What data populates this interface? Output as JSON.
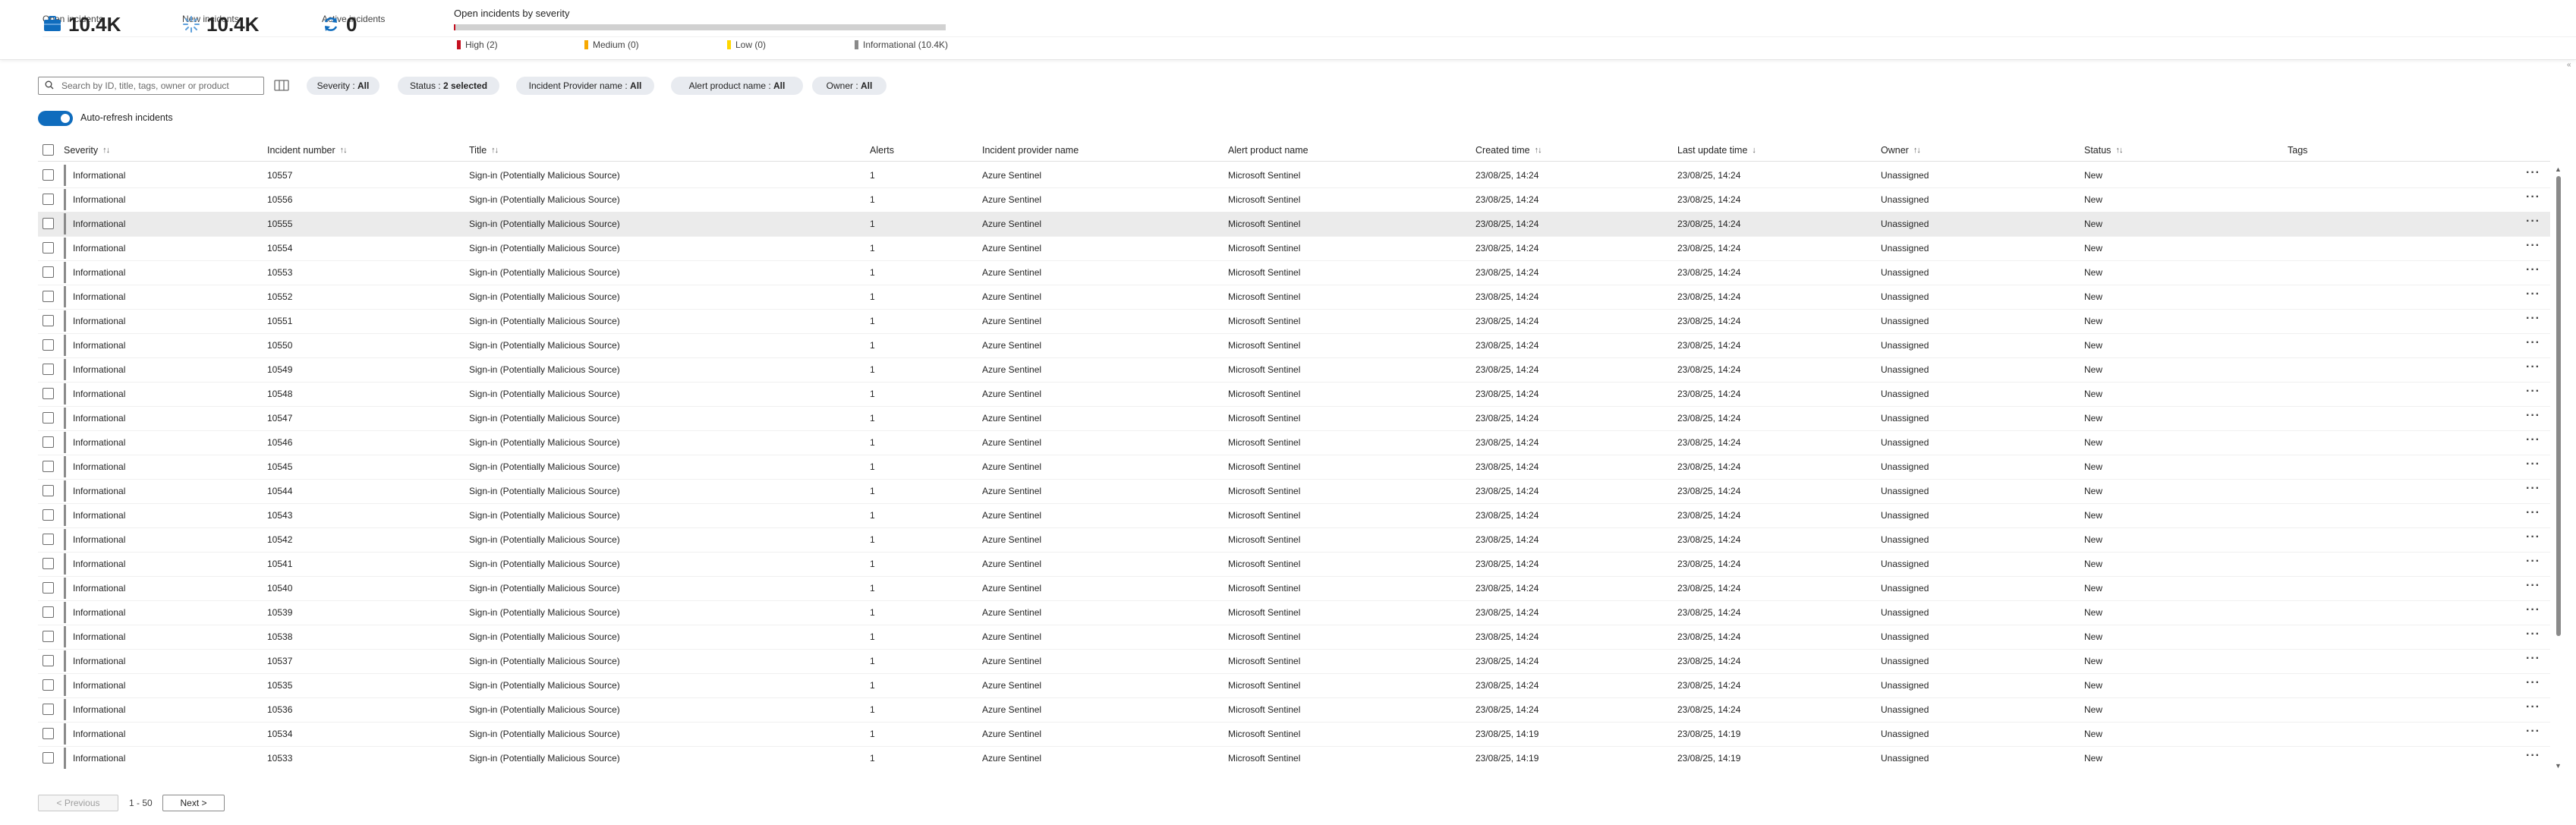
{
  "kpis": [
    {
      "value": "10.4K",
      "label": "Open incidents",
      "icon": "briefcase-icon"
    },
    {
      "value": "10.4K",
      "label": "New incidents",
      "icon": "sparkle-icon"
    },
    {
      "value": "0",
      "label": "Active incidents",
      "icon": "refresh-icon"
    }
  ],
  "severity_summary": {
    "title": "Open incidents by severity",
    "high_fraction": 0.0002,
    "legend": [
      {
        "label": "High (2)",
        "color": "#c50f1f"
      },
      {
        "label": "Medium (0)",
        "color": "#f7a800"
      },
      {
        "label": "Low (0)",
        "color": "#ffd700"
      },
      {
        "label": "Informational (10.4K)",
        "color": "#8a8a8a"
      }
    ]
  },
  "search": {
    "placeholder": "Search by ID, title, tags, owner or product",
    "value": ""
  },
  "filters": [
    {
      "name": "Severity : ",
      "value": "All"
    },
    {
      "name": "Status : ",
      "value": "2 selected"
    },
    {
      "name": "Incident Provider name : ",
      "value": "All"
    },
    {
      "name": "Alert product name : ",
      "value": "All"
    },
    {
      "name": "Owner : ",
      "value": "All"
    }
  ],
  "auto_refresh": {
    "label": "Auto-refresh incidents",
    "enabled": true
  },
  "columns": {
    "severity": "Severity",
    "number": "Incident number",
    "title": "Title",
    "alerts": "Alerts",
    "provider": "Incident provider name",
    "product": "Alert product name",
    "created": "Created time",
    "updated": "Last update time",
    "owner": "Owner",
    "status": "Status",
    "tags": "Tags"
  },
  "sort_icons": {
    "both": "↑↓",
    "desc": "↓"
  },
  "more_label": "···",
  "rows": [
    {
      "severity": "Informational",
      "number": "10557",
      "title": "Sign-in (Potentially Malicious Source)",
      "alerts": "1",
      "provider": "Azure Sentinel",
      "product": "Microsoft Sentinel",
      "created": "23/08/25, 14:24",
      "updated": "23/08/25, 14:24",
      "owner": "Unassigned",
      "status": "New",
      "tags": ""
    },
    {
      "severity": "Informational",
      "number": "10556",
      "title": "Sign-in (Potentially Malicious Source)",
      "alerts": "1",
      "provider": "Azure Sentinel",
      "product": "Microsoft Sentinel",
      "created": "23/08/25, 14:24",
      "updated": "23/08/25, 14:24",
      "owner": "Unassigned",
      "status": "New",
      "tags": ""
    },
    {
      "severity": "Informational",
      "number": "10555",
      "title": "Sign-in (Potentially Malicious Source)",
      "alerts": "1",
      "provider": "Azure Sentinel",
      "product": "Microsoft Sentinel",
      "created": "23/08/25, 14:24",
      "updated": "23/08/25, 14:24",
      "owner": "Unassigned",
      "status": "New",
      "tags": "",
      "highlighted": true
    },
    {
      "severity": "Informational",
      "number": "10554",
      "title": "Sign-in (Potentially Malicious Source)",
      "alerts": "1",
      "provider": "Azure Sentinel",
      "product": "Microsoft Sentinel",
      "created": "23/08/25, 14:24",
      "updated": "23/08/25, 14:24",
      "owner": "Unassigned",
      "status": "New",
      "tags": ""
    },
    {
      "severity": "Informational",
      "number": "10553",
      "title": "Sign-in (Potentially Malicious Source)",
      "alerts": "1",
      "provider": "Azure Sentinel",
      "product": "Microsoft Sentinel",
      "created": "23/08/25, 14:24",
      "updated": "23/08/25, 14:24",
      "owner": "Unassigned",
      "status": "New",
      "tags": ""
    },
    {
      "severity": "Informational",
      "number": "10552",
      "title": "Sign-in (Potentially Malicious Source)",
      "alerts": "1",
      "provider": "Azure Sentinel",
      "product": "Microsoft Sentinel",
      "created": "23/08/25, 14:24",
      "updated": "23/08/25, 14:24",
      "owner": "Unassigned",
      "status": "New",
      "tags": ""
    },
    {
      "severity": "Informational",
      "number": "10551",
      "title": "Sign-in (Potentially Malicious Source)",
      "alerts": "1",
      "provider": "Azure Sentinel",
      "product": "Microsoft Sentinel",
      "created": "23/08/25, 14:24",
      "updated": "23/08/25, 14:24",
      "owner": "Unassigned",
      "status": "New",
      "tags": ""
    },
    {
      "severity": "Informational",
      "number": "10550",
      "title": "Sign-in (Potentially Malicious Source)",
      "alerts": "1",
      "provider": "Azure Sentinel",
      "product": "Microsoft Sentinel",
      "created": "23/08/25, 14:24",
      "updated": "23/08/25, 14:24",
      "owner": "Unassigned",
      "status": "New",
      "tags": ""
    },
    {
      "severity": "Informational",
      "number": "10549",
      "title": "Sign-in (Potentially Malicious Source)",
      "alerts": "1",
      "provider": "Azure Sentinel",
      "product": "Microsoft Sentinel",
      "created": "23/08/25, 14:24",
      "updated": "23/08/25, 14:24",
      "owner": "Unassigned",
      "status": "New",
      "tags": ""
    },
    {
      "severity": "Informational",
      "number": "10548",
      "title": "Sign-in (Potentially Malicious Source)",
      "alerts": "1",
      "provider": "Azure Sentinel",
      "product": "Microsoft Sentinel",
      "created": "23/08/25, 14:24",
      "updated": "23/08/25, 14:24",
      "owner": "Unassigned",
      "status": "New",
      "tags": ""
    },
    {
      "severity": "Informational",
      "number": "10547",
      "title": "Sign-in (Potentially Malicious Source)",
      "alerts": "1",
      "provider": "Azure Sentinel",
      "product": "Microsoft Sentinel",
      "created": "23/08/25, 14:24",
      "updated": "23/08/25, 14:24",
      "owner": "Unassigned",
      "status": "New",
      "tags": ""
    },
    {
      "severity": "Informational",
      "number": "10546",
      "title": "Sign-in (Potentially Malicious Source)",
      "alerts": "1",
      "provider": "Azure Sentinel",
      "product": "Microsoft Sentinel",
      "created": "23/08/25, 14:24",
      "updated": "23/08/25, 14:24",
      "owner": "Unassigned",
      "status": "New",
      "tags": ""
    },
    {
      "severity": "Informational",
      "number": "10545",
      "title": "Sign-in (Potentially Malicious Source)",
      "alerts": "1",
      "provider": "Azure Sentinel",
      "product": "Microsoft Sentinel",
      "created": "23/08/25, 14:24",
      "updated": "23/08/25, 14:24",
      "owner": "Unassigned",
      "status": "New",
      "tags": ""
    },
    {
      "severity": "Informational",
      "number": "10544",
      "title": "Sign-in (Potentially Malicious Source)",
      "alerts": "1",
      "provider": "Azure Sentinel",
      "product": "Microsoft Sentinel",
      "created": "23/08/25, 14:24",
      "updated": "23/08/25, 14:24",
      "owner": "Unassigned",
      "status": "New",
      "tags": ""
    },
    {
      "severity": "Informational",
      "number": "10543",
      "title": "Sign-in (Potentially Malicious Source)",
      "alerts": "1",
      "provider": "Azure Sentinel",
      "product": "Microsoft Sentinel",
      "created": "23/08/25, 14:24",
      "updated": "23/08/25, 14:24",
      "owner": "Unassigned",
      "status": "New",
      "tags": ""
    },
    {
      "severity": "Informational",
      "number": "10542",
      "title": "Sign-in (Potentially Malicious Source)",
      "alerts": "1",
      "provider": "Azure Sentinel",
      "product": "Microsoft Sentinel",
      "created": "23/08/25, 14:24",
      "updated": "23/08/25, 14:24",
      "owner": "Unassigned",
      "status": "New",
      "tags": ""
    },
    {
      "severity": "Informational",
      "number": "10541",
      "title": "Sign-in (Potentially Malicious Source)",
      "alerts": "1",
      "provider": "Azure Sentinel",
      "product": "Microsoft Sentinel",
      "created": "23/08/25, 14:24",
      "updated": "23/08/25, 14:24",
      "owner": "Unassigned",
      "status": "New",
      "tags": ""
    },
    {
      "severity": "Informational",
      "number": "10540",
      "title": "Sign-in (Potentially Malicious Source)",
      "alerts": "1",
      "provider": "Azure Sentinel",
      "product": "Microsoft Sentinel",
      "created": "23/08/25, 14:24",
      "updated": "23/08/25, 14:24",
      "owner": "Unassigned",
      "status": "New",
      "tags": ""
    },
    {
      "severity": "Informational",
      "number": "10539",
      "title": "Sign-in (Potentially Malicious Source)",
      "alerts": "1",
      "provider": "Azure Sentinel",
      "product": "Microsoft Sentinel",
      "created": "23/08/25, 14:24",
      "updated": "23/08/25, 14:24",
      "owner": "Unassigned",
      "status": "New",
      "tags": ""
    },
    {
      "severity": "Informational",
      "number": "10538",
      "title": "Sign-in (Potentially Malicious Source)",
      "alerts": "1",
      "provider": "Azure Sentinel",
      "product": "Microsoft Sentinel",
      "created": "23/08/25, 14:24",
      "updated": "23/08/25, 14:24",
      "owner": "Unassigned",
      "status": "New",
      "tags": ""
    },
    {
      "severity": "Informational",
      "number": "10537",
      "title": "Sign-in (Potentially Malicious Source)",
      "alerts": "1",
      "provider": "Azure Sentinel",
      "product": "Microsoft Sentinel",
      "created": "23/08/25, 14:24",
      "updated": "23/08/25, 14:24",
      "owner": "Unassigned",
      "status": "New",
      "tags": ""
    },
    {
      "severity": "Informational",
      "number": "10535",
      "title": "Sign-in (Potentially Malicious Source)",
      "alerts": "1",
      "provider": "Azure Sentinel",
      "product": "Microsoft Sentinel",
      "created": "23/08/25, 14:24",
      "updated": "23/08/25, 14:24",
      "owner": "Unassigned",
      "status": "New",
      "tags": ""
    },
    {
      "severity": "Informational",
      "number": "10536",
      "title": "Sign-in (Potentially Malicious Source)",
      "alerts": "1",
      "provider": "Azure Sentinel",
      "product": "Microsoft Sentinel",
      "created": "23/08/25, 14:24",
      "updated": "23/08/25, 14:24",
      "owner": "Unassigned",
      "status": "New",
      "tags": ""
    },
    {
      "severity": "Informational",
      "number": "10534",
      "title": "Sign-in (Potentially Malicious Source)",
      "alerts": "1",
      "provider": "Azure Sentinel",
      "product": "Microsoft Sentinel",
      "created": "23/08/25, 14:19",
      "updated": "23/08/25, 14:19",
      "owner": "Unassigned",
      "status": "New",
      "tags": ""
    },
    {
      "severity": "Informational",
      "number": "10533",
      "title": "Sign-in (Potentially Malicious Source)",
      "alerts": "1",
      "provider": "Azure Sentinel",
      "product": "Microsoft Sentinel",
      "created": "23/08/25, 14:19",
      "updated": "23/08/25, 14:19",
      "owner": "Unassigned",
      "status": "New",
      "tags": ""
    }
  ],
  "pager": {
    "previous": "< Previous",
    "range": "1 - 50",
    "next": "Next >"
  },
  "colors": {
    "accent": "#0f6cbd",
    "severity_informational": "#8a8a8a"
  }
}
